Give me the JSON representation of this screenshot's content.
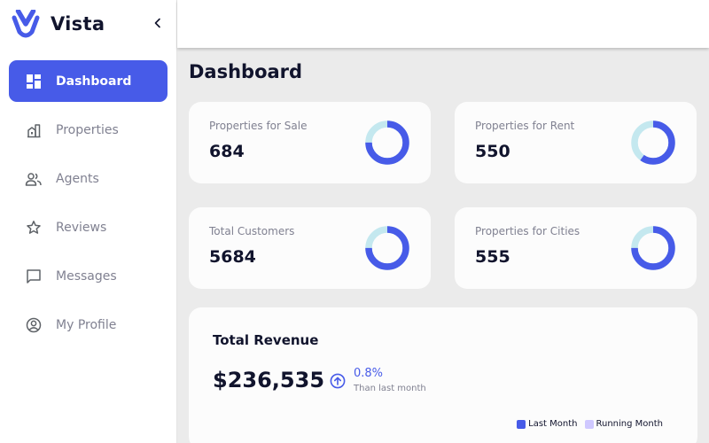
{
  "brand": {
    "name": "Vista"
  },
  "sidebar": {
    "items": [
      {
        "label": "Dashboard",
        "icon": "dashboard-icon",
        "active": true
      },
      {
        "label": "Properties",
        "icon": "building-icon",
        "active": false
      },
      {
        "label": "Agents",
        "icon": "people-icon",
        "active": false
      },
      {
        "label": "Reviews",
        "icon": "star-icon",
        "active": false
      },
      {
        "label": "Messages",
        "icon": "chat-icon",
        "active": false
      },
      {
        "label": "My Profile",
        "icon": "profile-icon",
        "active": false
      }
    ]
  },
  "page": {
    "title": "Dashboard"
  },
  "stats": [
    {
      "label": "Properties for Sale",
      "value": "684",
      "fill_fraction": 0.75
    },
    {
      "label": "Properties for Rent",
      "value": "550",
      "fill_fraction": 0.6
    },
    {
      "label": "Total Customers",
      "value": "5684",
      "fill_fraction": 0.75
    },
    {
      "label": "Properties for Cities",
      "value": "555",
      "fill_fraction": 0.75
    }
  ],
  "revenue": {
    "title": "Total Revenue",
    "amount": "$236,535",
    "change": "0.8%",
    "compare_text": "Than last month",
    "legend": [
      {
        "label": "Last Month",
        "color": "#475be8"
      },
      {
        "label": "Running Month",
        "color": "#cfc8ff"
      }
    ]
  },
  "colors": {
    "accent": "#475be8",
    "donut_track": "#c4e8ef",
    "text_primary": "#11142d",
    "text_secondary": "#808191"
  }
}
